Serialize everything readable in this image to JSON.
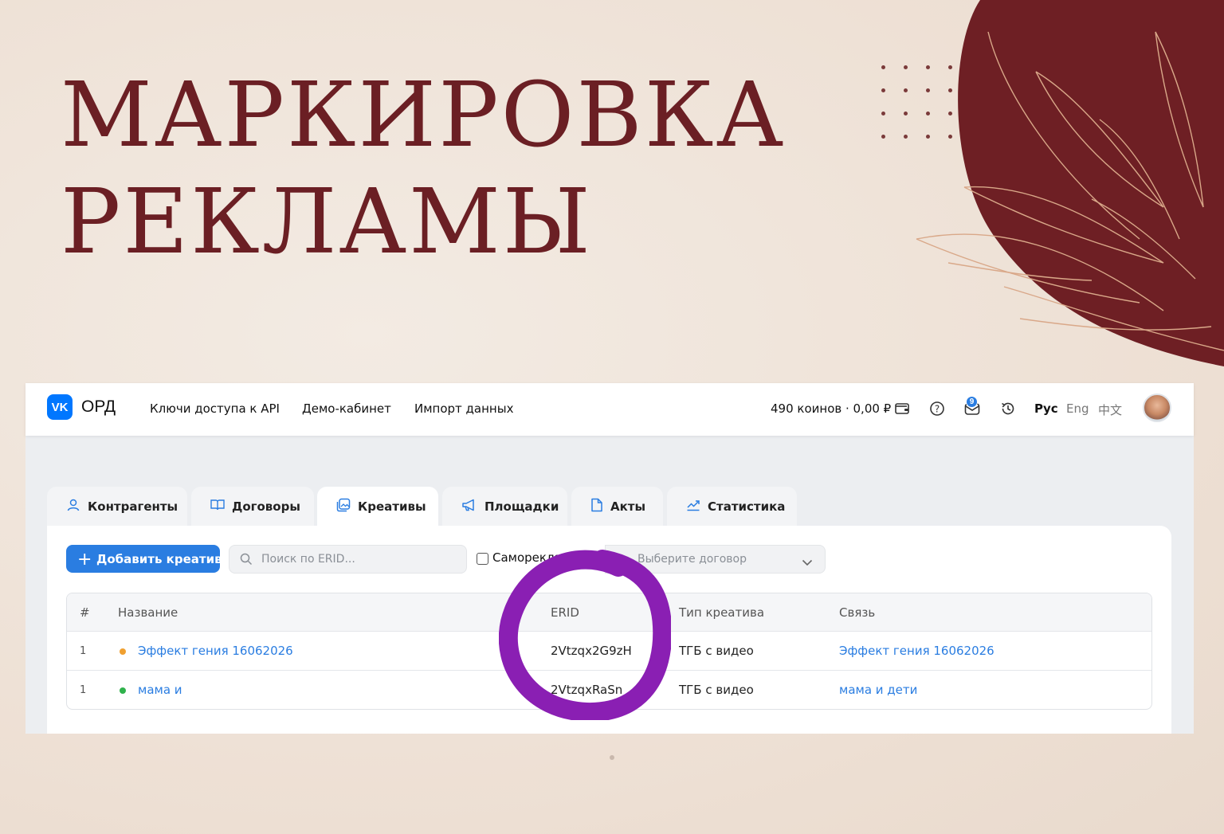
{
  "colors": {
    "headline": "#6b1f24",
    "accent": "#2a7de1",
    "highlight_circle": "#8a1fb3",
    "brand_blue": "#0077ff"
  },
  "headline": {
    "line1": "МАРКИРОВКА",
    "line2": "РЕКЛАМЫ"
  },
  "topbar": {
    "logo_text": "VK",
    "brand": "ОРД",
    "nav": [
      "Ключи доступа к API",
      "Демо-кабинет",
      "Импорт данных"
    ],
    "balance": "490 коинов · 0,00 ₽",
    "notifications_count": "9",
    "languages": [
      "Рус",
      "Eng",
      "中文"
    ],
    "icons": [
      "wallet-icon",
      "help-icon",
      "mail-icon",
      "history-icon"
    ]
  },
  "tabs": [
    {
      "label": "Контрагенты",
      "icon": "person-icon"
    },
    {
      "label": "Договоры",
      "icon": "book-icon"
    },
    {
      "label": "Креативы",
      "icon": "creative-icon"
    },
    {
      "label": "Площадки",
      "icon": "megaphone-icon"
    },
    {
      "label": "Акты",
      "icon": "document-icon"
    },
    {
      "label": "Статистика",
      "icon": "chart-icon"
    }
  ],
  "toolbar": {
    "add_label": "Добавить креатив",
    "search_placeholder": "Поиск по ERID...",
    "self_ad_label": "Самореклама",
    "contract_placeholder": "Выберите договор"
  },
  "table": {
    "headers": [
      "#",
      "Название",
      "ERID",
      "Тип креатива",
      "Связь"
    ],
    "rows": [
      {
        "num": "1",
        "name": "Эффект гения 16062026",
        "status_color": "#f0a030",
        "erid": "2Vtzqx2G9zH",
        "type": "ТГБ с видео",
        "link": "Эффект гения 16062026"
      },
      {
        "num": "1",
        "name": "мама и",
        "status_color": "#2fb24c",
        "erid": "2VtzqxRaSn",
        "type": "ТГБ с видео",
        "link": "мама и дети"
      }
    ]
  }
}
